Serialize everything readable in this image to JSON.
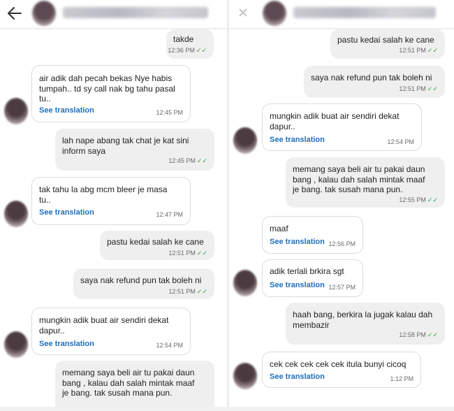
{
  "see_translation": "See translation",
  "left": {
    "messages": [
      {
        "text": "takde",
        "time": "12:36 PM"
      },
      {
        "text": "air adik dah pecah bekas Nye habis\ntumpah.. td sy call nak bg tahu pasal\ntu..",
        "time": "12:45 PM"
      },
      {
        "text": "lah nape abang tak chat je kat sini\ninform saya",
        "time": "12:45 PM"
      },
      {
        "text": "tak tahu la abg mcm bleer je masa\ntu..",
        "time": "12:47 PM"
      },
      {
        "text": "pastu kedai salah ke cane",
        "time": "12:51 PM"
      },
      {
        "text": "saya nak refund pun tak boleh ni",
        "time": "12:51 PM"
      },
      {
        "text": "mungkin adik buat air sendiri dekat\ndapur..",
        "time": "12:54 PM"
      },
      {
        "text": "memang saya beli air tu pakai daun\nbang , kalau dah salah mintak maaf\nje bang. tak susah mana pun.",
        "time": ""
      }
    ]
  },
  "right": {
    "messages": [
      {
        "text": "pastu kedai salah ke cane",
        "time": "12:51 PM"
      },
      {
        "text": "saya nak refund pun tak boleh ni",
        "time": "12:51 PM"
      },
      {
        "text": "mungkin adik buat air sendiri dekat\ndapur..",
        "time": "12:54 PM"
      },
      {
        "text": "memang saya beli air tu pakai daun\nbang , kalau dah salah mintak maaf\nje bang. tak susah mana pun.",
        "time": "12:55 PM"
      },
      {
        "text": "maaf",
        "time": "12:56 PM"
      },
      {
        "text": "adik terlali brkira sgt",
        "time": "12:57 PM"
      },
      {
        "text": "haah bang, berkira la jugak kalau dah\nmembazir",
        "time": "12:58 PM"
      },
      {
        "text": "cek cek cek cek cek itula bunyi cicoq",
        "time": "1:12 PM"
      }
    ]
  },
  "icons": {
    "back": "arrow-left-icon",
    "read_receipt": "double-check-icon"
  },
  "colors": {
    "translation_link": "#1e6fbe",
    "read_check": "#2e9b48",
    "outgoing_bubble": "#efefef",
    "incoming_bubble": "#ffffff"
  }
}
